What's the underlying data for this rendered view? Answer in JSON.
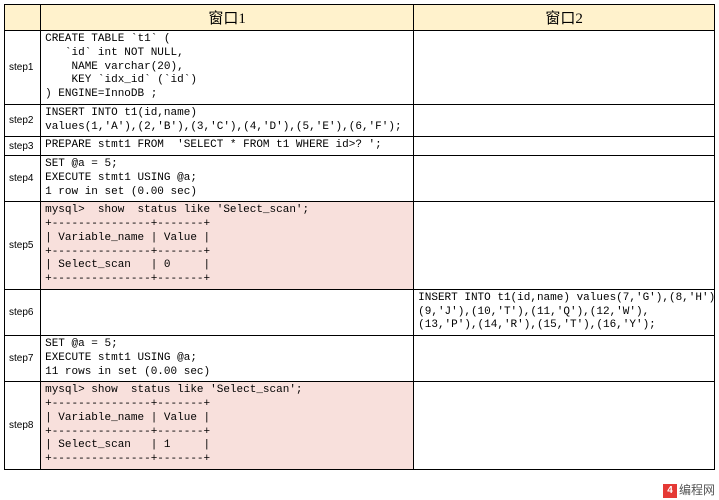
{
  "headers": {
    "step": "",
    "win1": "窗口1",
    "win2": "窗口2"
  },
  "rows": [
    {
      "step": "step1",
      "win1": "CREATE TABLE `t1` (\n   `id` int NOT NULL,\n    NAME varchar(20),\n    KEY `idx_id` (`id`)\n) ENGINE=InnoDB ;",
      "win2": "",
      "hl1": false
    },
    {
      "step": "step2",
      "win1": "INSERT INTO t1(id,name)\nvalues(1,'A'),(2,'B'),(3,'C'),(4,'D'),(5,'E'),(6,'F');",
      "win2": "",
      "hl1": false
    },
    {
      "step": "step3",
      "win1": "PREPARE stmt1 FROM  'SELECT * FROM t1 WHERE id>? ';",
      "win2": "",
      "hl1": false
    },
    {
      "step": "step4",
      "win1": "SET @a = 5;\nEXECUTE stmt1 USING @a;\n1 row in set (0.00 sec)",
      "win2": "",
      "hl1": false
    },
    {
      "step": "step5",
      "win1": "mysql>  show  status like 'Select_scan';\n+---------------+-------+\n| Variable_name | Value |\n+---------------+-------+\n| Select_scan   | 0     |\n+---------------+-------+",
      "win2": "",
      "hl1": true
    },
    {
      "step": "step6",
      "win1": "",
      "win2": "INSERT INTO t1(id,name) values(7,'G'),(8,'H'),\n(9,'J'),(10,'T'),(11,'Q'),(12,'W'),\n(13,'P'),(14,'R'),(15,'T'),(16,'Y');",
      "hl1": false
    },
    {
      "step": "step7",
      "win1": "SET @a = 5;\nEXECUTE stmt1 USING @a;\n11 rows in set (0.00 sec)",
      "win2": "",
      "hl1": false
    },
    {
      "step": "step8",
      "win1": "mysql> show  status like 'Select_scan';\n+---------------+-------+\n| Variable_name | Value |\n+---------------+-------+\n| Select_scan   | 1     |\n+---------------+-------+",
      "win2": "",
      "hl1": true
    }
  ],
  "watermark": "编程网"
}
